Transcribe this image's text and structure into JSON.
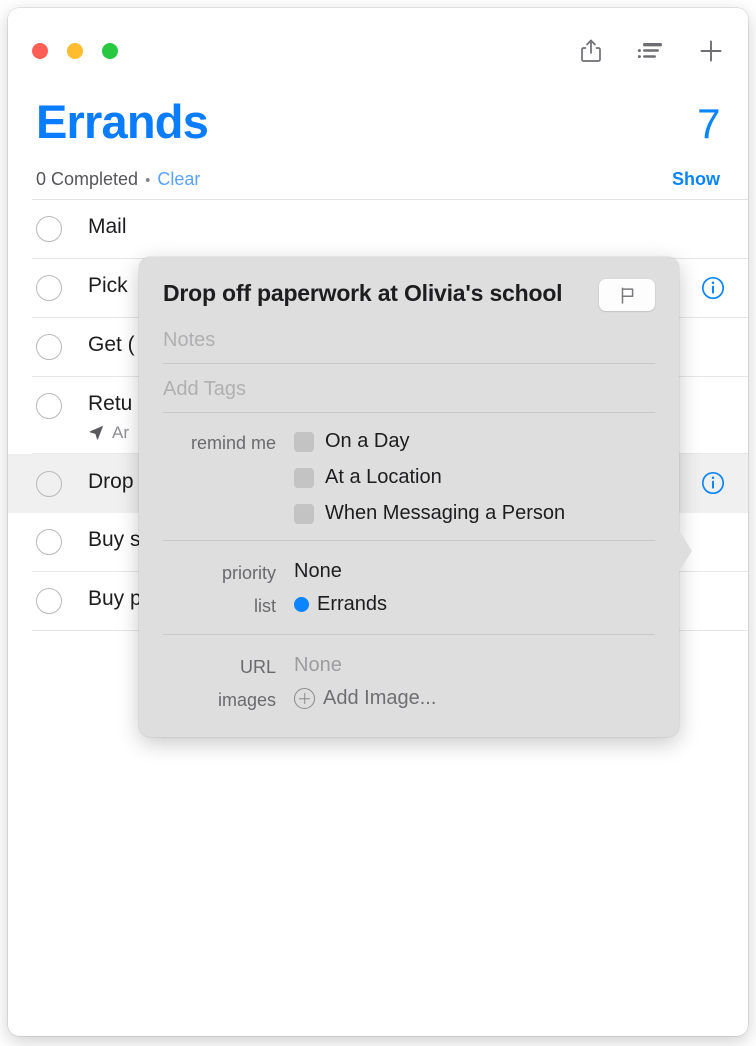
{
  "window": {
    "traffic_lights": [
      {
        "name": "close",
        "color": "#ff5f57"
      },
      {
        "name": "minimize",
        "color": "#febc2e"
      },
      {
        "name": "zoom",
        "color": "#28c840"
      }
    ],
    "toolbar": [
      {
        "icon": "share-icon",
        "label": "Share"
      },
      {
        "icon": "list-options-icon",
        "label": "List Options"
      },
      {
        "icon": "plus-icon",
        "label": "Add Reminder"
      }
    ]
  },
  "header": {
    "title": "Errands",
    "count": "7",
    "completed_text": "0 Completed",
    "separator": "•",
    "clear_label": "Clear",
    "show_label": "Show",
    "accent_color": "#0a84ff"
  },
  "reminders": [
    {
      "text": "Mail",
      "sub": "",
      "selected": false,
      "info": false
    },
    {
      "text": "Pick",
      "sub": "",
      "selected": false,
      "info": true
    },
    {
      "text": "Get (",
      "sub": "",
      "selected": false,
      "info": false
    },
    {
      "text": "Retu",
      "sub": "Ar",
      "sub_icon": "location-arrow-icon",
      "selected": false,
      "info": false
    },
    {
      "text": "Drop",
      "sub": "",
      "selected": true,
      "info": true
    },
    {
      "text": "Buy s",
      "sub": "",
      "selected": false,
      "info": false
    },
    {
      "text": "Buy p",
      "sub": "",
      "selected": false,
      "info": false
    }
  ],
  "popover": {
    "title": "Drop off paperwork at Olivia's school",
    "flag_icon": "flag-icon",
    "notes_placeholder": "Notes",
    "tags_placeholder": "Add Tags",
    "remind_me_label": "remind me",
    "remind_options": [
      {
        "label": "On a Day",
        "checked": false
      },
      {
        "label": "At a Location",
        "checked": false
      },
      {
        "label": "When Messaging a Person",
        "checked": false
      }
    ],
    "priority_label": "priority",
    "priority_value": "None",
    "list_label": "list",
    "list_value": "Errands",
    "list_color": "#0a84ff",
    "url_label": "URL",
    "url_value": "None",
    "images_label": "images",
    "add_image_label": "Add Image..."
  }
}
